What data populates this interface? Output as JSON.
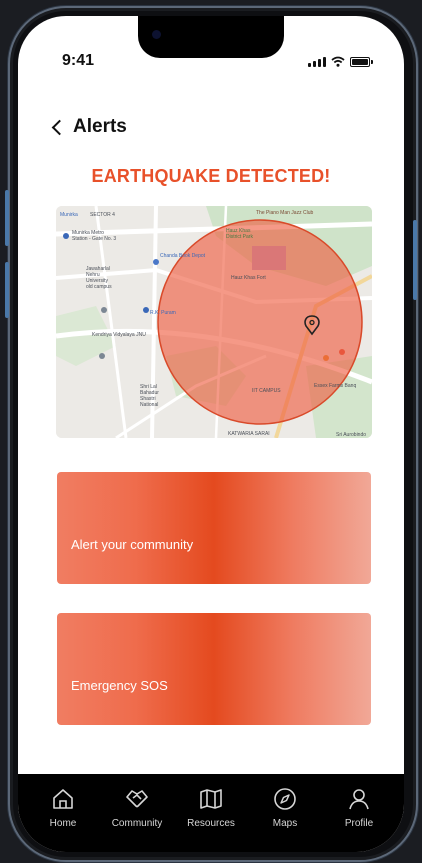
{
  "status_bar": {
    "time": "9:41"
  },
  "header": {
    "title": "Alerts"
  },
  "alert": {
    "heading": "EARTHQUAKE DETECTED!"
  },
  "map": {
    "labels": [
      "Munirka",
      "SECTOR 4",
      "Munirka Metro",
      "Station - Gate No. 3",
      "Jawaharlal",
      "Nehru",
      "University",
      "old campus",
      "Kendriya Vidyalaya JNU",
      "R.K. Puram",
      "Hauz Khas Fort",
      "Hauz Khas",
      "District Park",
      "The Piano Man Jazz Club",
      "IIT CAMPUS",
      "Sri Aurobindo",
      "Shri Lal",
      "Bahadur",
      "Shastri",
      "National",
      "KATWARIA SARAI",
      "Essex Farms Banq",
      "Chanda Book Depot"
    ],
    "alert_zone_color": "#ef5b3d"
  },
  "actions": {
    "community": "Alert your community",
    "sos": "Emergency SOS"
  },
  "colors": {
    "accent": "#e8512a",
    "tabbar": "#000000"
  },
  "tabs": [
    {
      "label": "Home",
      "icon": "home-icon"
    },
    {
      "label": "Community",
      "icon": "handshake-icon"
    },
    {
      "label": "Resources",
      "icon": "map-book-icon"
    },
    {
      "label": "Maps",
      "icon": "compass-icon"
    },
    {
      "label": "Profile",
      "icon": "person-icon"
    }
  ]
}
